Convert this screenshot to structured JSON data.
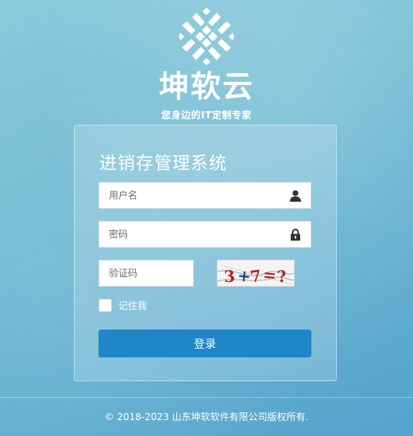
{
  "brand": {
    "name": "坤软云",
    "slogan": "您身边的IT定制专家",
    "logo_icon": "kunruan-logo-icon"
  },
  "login_panel": {
    "title": "进销存管理系统",
    "username": {
      "placeholder": "用户名",
      "value": "",
      "icon": "user-icon"
    },
    "password": {
      "placeholder": "密码",
      "value": "",
      "icon": "lock-icon"
    },
    "captcha": {
      "placeholder": "验证码",
      "value": "",
      "image_text": "3+7=?"
    },
    "remember_me": {
      "label": "记住我",
      "checked": false
    },
    "login_button": "登录"
  },
  "footer": {
    "copyright": "© 2018-2023 山东坤软软件有限公司版权所有."
  },
  "colors": {
    "primary_button": "#1e86c9",
    "background_light": "#8ccbdb",
    "background_dark": "#55a3cc"
  }
}
